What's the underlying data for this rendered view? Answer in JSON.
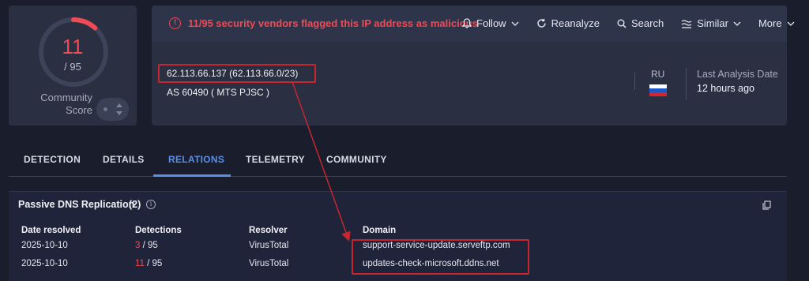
{
  "score": {
    "detected": "11",
    "total_label": "/ 95",
    "fraction": 0.1158,
    "community_label": "Community Score"
  },
  "alert": {
    "text": "11/95 security vendors flagged this IP address as malicious",
    "icon": "alert-circle-icon"
  },
  "toolbar": {
    "follow": "Follow",
    "reanalyze": "Reanalyze",
    "search": "Search",
    "similar": "Similar",
    "more": "More"
  },
  "ip": {
    "address": "62.113.66.137  (62.113.66.0/23)",
    "as": "AS 60490  ( MTS PJSC )",
    "country": "RU",
    "last_analysis_label": "Last Analysis Date",
    "last_analysis_value": "12 hours ago"
  },
  "tabs": [
    {
      "label": "DETECTION"
    },
    {
      "label": "DETAILS"
    },
    {
      "label": "RELATIONS"
    },
    {
      "label": "TELEMETRY"
    },
    {
      "label": "COMMUNITY"
    }
  ],
  "passive_dns": {
    "title": "Passive DNS Replication",
    "count": "(2)",
    "headers": [
      "Date resolved",
      "Detections",
      "Resolver",
      "Domain"
    ],
    "rows": [
      {
        "date": "2025-10-10",
        "hits": "3",
        "total": " / 95",
        "resolver": "VirusTotal",
        "domain": "support-service-update.serveftp.com"
      },
      {
        "date": "2025-10-10",
        "hits": "11",
        "total": " / 95",
        "resolver": "VirusTotal",
        "domain": "updates-check-microsoft.ddns.net"
      }
    ]
  },
  "colors": {
    "malicious": "#ee4b55",
    "accent": "#5a8fe8",
    "highlight_box": "#c6262e"
  }
}
